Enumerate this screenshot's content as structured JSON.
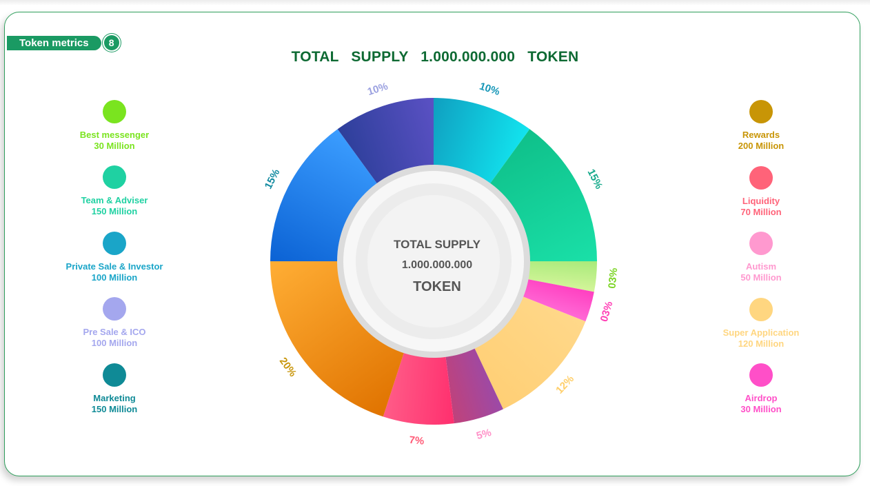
{
  "badge": {
    "label": "Token metrics",
    "number": "8"
  },
  "headline": "TOTAL SUPPLY  1.000.000.000  TOKEN",
  "center": {
    "line1": "TOTAL SUPPLY",
    "line2": "1.000.000.000",
    "line3": "TOKEN"
  },
  "legend_left": [
    {
      "label": "Best messenger",
      "value": "30 Million",
      "color": "#7ae41f"
    },
    {
      "label": "Team & Adviser",
      "value": "150 Million",
      "color": "#1fd1a2"
    },
    {
      "label": "Private Sale & Investor",
      "value": "100 Million",
      "color": "#1aa5c8"
    },
    {
      "label": "Pre Sale & ICO",
      "value": "100 Million",
      "color": "#a4a7ee"
    },
    {
      "label": "Marketing",
      "value": "150 Million",
      "color": "#0f8a96"
    }
  ],
  "legend_right": [
    {
      "label": "Rewards",
      "value": "200 Million",
      "color": "#c89506"
    },
    {
      "label": "Liquidity",
      "value": "70 Million",
      "color": "#ff6379"
    },
    {
      "label": "Autism",
      "value": "50 Million",
      "color": "#ff99cf"
    },
    {
      "label": "Super Application",
      "value": "120 Million",
      "color": "#ffd680"
    },
    {
      "label": "Airdrop",
      "value": "30 Million",
      "color": "#ff4fc8"
    }
  ],
  "chart_data": {
    "type": "pie",
    "slices": [
      {
        "label": "10%",
        "value": 10,
        "color_a": "#0f9fc0",
        "color_b": "#12e4ef",
        "label_color": "#1797b8"
      },
      {
        "label": "15%",
        "value": 15,
        "color_a": "#0fc08a",
        "color_b": "#1ae0a8",
        "label_color": "#14a98a"
      },
      {
        "label": "03%",
        "value": 3,
        "color_a": "#a8ea7a",
        "color_b": "#d4f59a",
        "label_color": "#7ad422"
      },
      {
        "label": "03%",
        "value": 3,
        "color_a": "#ff3fc0",
        "color_b": "#ff6ad6",
        "label_color": "#ff3fb5"
      },
      {
        "label": "12%",
        "value": 12,
        "color_a": "#ffd88a",
        "color_b": "#ffcf75",
        "label_color": "#ffcf6a"
      },
      {
        "label": "5%",
        "value": 5,
        "color_a": "#9b4aa8",
        "color_b": "#c0427a",
        "label_color": "#ff92c8"
      },
      {
        "label": "7%",
        "value": 7,
        "color_a": "#ff2f6e",
        "color_b": "#ff5c88",
        "label_color": "#ff5a76"
      },
      {
        "label": "20%",
        "value": 20,
        "color_a": "#e07300",
        "color_b": "#ffae35",
        "label_color": "#c8950a"
      },
      {
        "label": "15%",
        "value": 15,
        "color_a": "#0b62d4",
        "color_b": "#3b9dff",
        "label_color": "#128aa0"
      },
      {
        "label": "10%",
        "value": 10,
        "color_a": "#2d3f9a",
        "color_b": "#5b51c4",
        "label_color": "#9aa0e0"
      }
    ]
  }
}
